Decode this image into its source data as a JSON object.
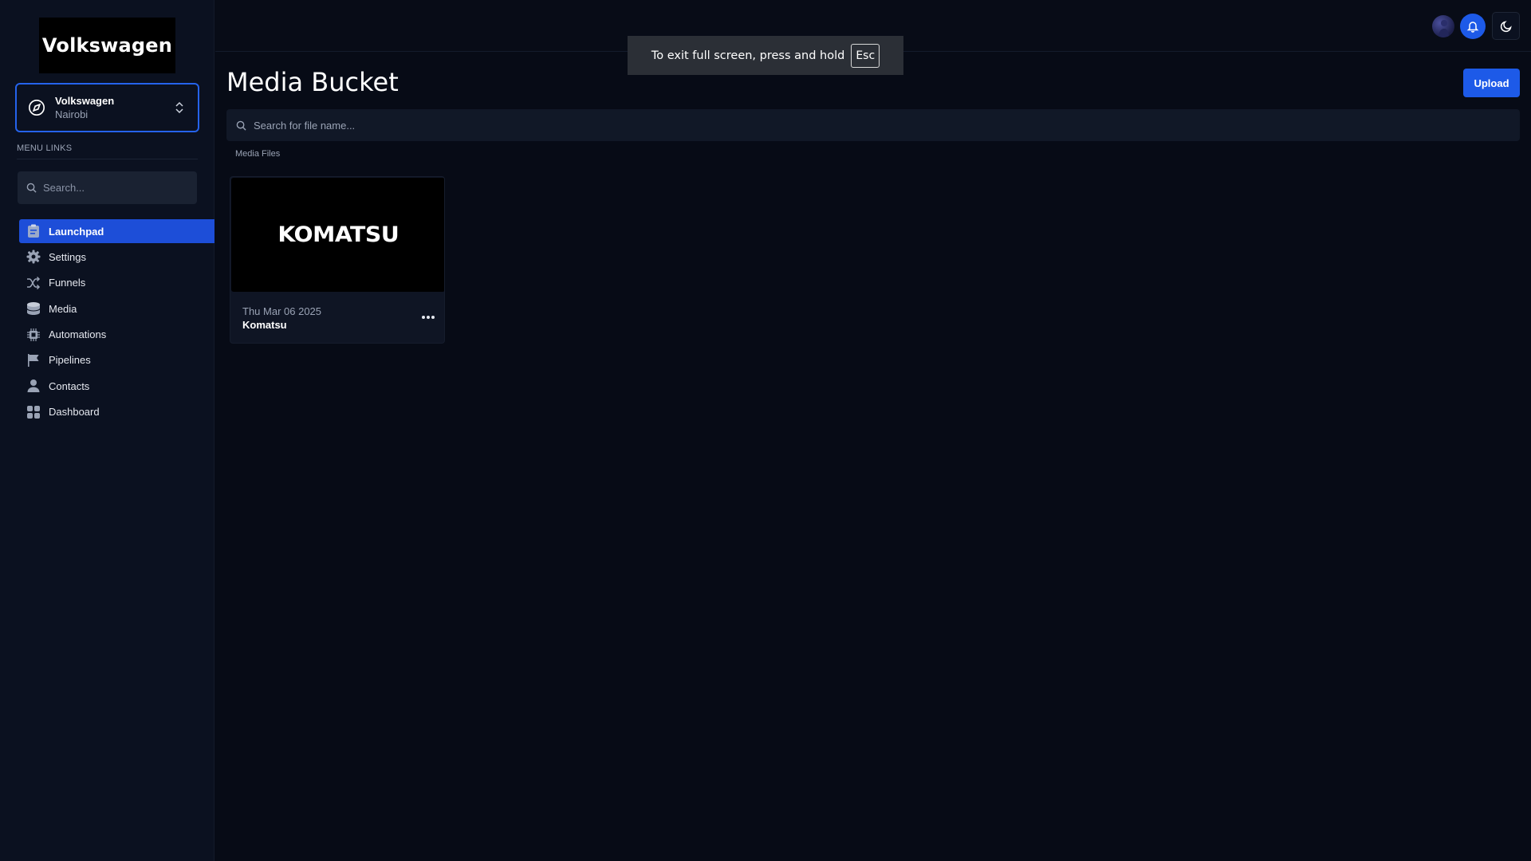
{
  "sidebar": {
    "logo_text": "Volkswagen",
    "account": {
      "name": "Volkswagen",
      "location": "Nairobi"
    },
    "menu_label": "MENU LINKS",
    "search_placeholder": "Search...",
    "items": [
      {
        "label": "Launchpad",
        "icon": "clipboard-icon",
        "active": true
      },
      {
        "label": "Settings",
        "icon": "gear-icon"
      },
      {
        "label": "Funnels",
        "icon": "shuffle-icon"
      },
      {
        "label": "Media",
        "icon": "database-icon"
      },
      {
        "label": "Automations",
        "icon": "cpu-icon"
      },
      {
        "label": "Pipelines",
        "icon": "flag-icon"
      },
      {
        "label": "Contacts",
        "icon": "user-icon"
      },
      {
        "label": "Dashboard",
        "icon": "grid-icon"
      }
    ]
  },
  "toast": {
    "text": "To exit full screen, press and hold",
    "key": "Esc"
  },
  "main": {
    "title": "Media Bucket",
    "upload_label": "Upload",
    "search_placeholder": "Search for file name...",
    "section_label": "Media Files",
    "files": [
      {
        "logo_text": "KOMATSU",
        "date": "Thu Mar 06 2025",
        "name": "Komatsu"
      }
    ]
  },
  "colors": {
    "accent": "#1d5ae8",
    "background": "#070b16",
    "sidebar": "#0b1120"
  }
}
